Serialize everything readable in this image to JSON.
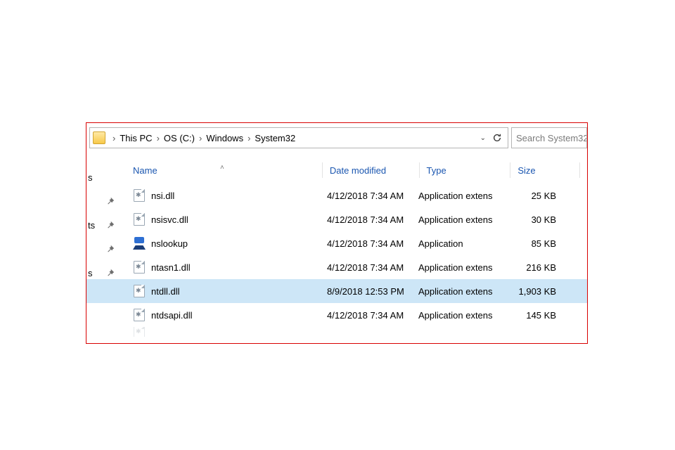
{
  "breadcrumb": [
    "This PC",
    "OS (C:)",
    "Windows",
    "System32"
  ],
  "search_placeholder": "Search System32",
  "columns": {
    "name": "Name",
    "date": "Date modified",
    "type": "Type",
    "size": "Size"
  },
  "nav_fragments": [
    "s",
    "",
    "ts",
    "",
    "s"
  ],
  "files": [
    {
      "name": "nsi.dll",
      "date": "4/12/2018 7:34 AM",
      "type": "Application extens",
      "size": "25 KB",
      "icon": "gear-page",
      "selected": false
    },
    {
      "name": "nsisvc.dll",
      "date": "4/12/2018 7:34 AM",
      "type": "Application extens",
      "size": "30 KB",
      "icon": "gear-page",
      "selected": false
    },
    {
      "name": "nslookup",
      "date": "4/12/2018 7:34 AM",
      "type": "Application",
      "size": "85 KB",
      "icon": "nslookup",
      "selected": false
    },
    {
      "name": "ntasn1.dll",
      "date": "4/12/2018 7:34 AM",
      "type": "Application extens",
      "size": "216 KB",
      "icon": "gear-page",
      "selected": false
    },
    {
      "name": "ntdll.dll",
      "date": "8/9/2018 12:53 PM",
      "type": "Application extens",
      "size": "1,903 KB",
      "icon": "gear-page",
      "selected": true
    },
    {
      "name": "ntdsapi.dll",
      "date": "4/12/2018 7:34 AM",
      "type": "Application extens",
      "size": "145 KB",
      "icon": "gear-page",
      "selected": false
    }
  ]
}
